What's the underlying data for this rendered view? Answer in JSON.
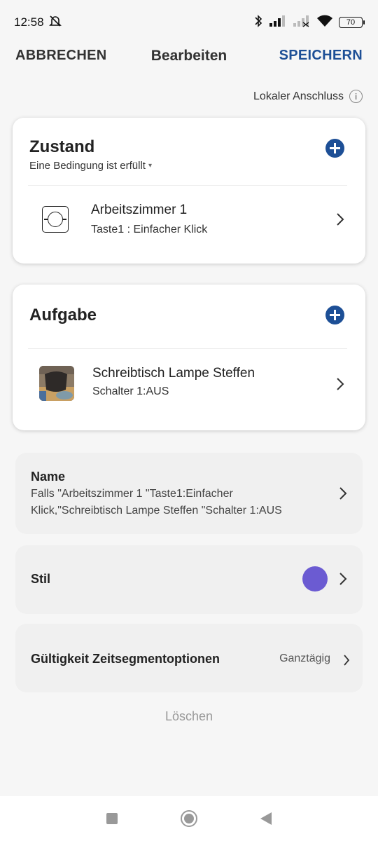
{
  "status_bar": {
    "time": "12:58",
    "battery": "70"
  },
  "header": {
    "cancel_label": "ABBRECHEN",
    "title": "Bearbeiten",
    "save_label": "SPEICHERN"
  },
  "local_connection": {
    "label": "Lokaler Anschluss"
  },
  "condition_card": {
    "title": "Zustand",
    "subtitle": "Eine Bedingung ist erfüllt",
    "item": {
      "title": "Arbeitszimmer 1",
      "subtitle": "Taste1 : Einfacher Klick"
    }
  },
  "task_card": {
    "title": "Aufgabe",
    "item": {
      "title": "Schreibtisch Lampe Steffen",
      "subtitle": "Schalter 1:AUS"
    }
  },
  "name_panel": {
    "title": "Name",
    "value": "Falls \"Arbeitszimmer 1 \"Taste1:Einfacher Klick,\"Schreibtisch Lampe Steffen \"Schalter 1:AUS"
  },
  "style_panel": {
    "title": "Stil",
    "color": "#6b5bd2"
  },
  "validity_panel": {
    "title": "Gültigkeit Zeitsegmentoptionen",
    "value": "Ganztägig"
  },
  "delete_label": "Löschen",
  "colors": {
    "accent": "#1d4f96",
    "background": "#f6f6f6"
  },
  "icons": {
    "condition_item": "wall-switch-icon",
    "task_item": "lamp-photo-thumbnail",
    "add": "plus-circle-icon",
    "chevron": "chevron-right-icon",
    "info": "info-icon"
  }
}
